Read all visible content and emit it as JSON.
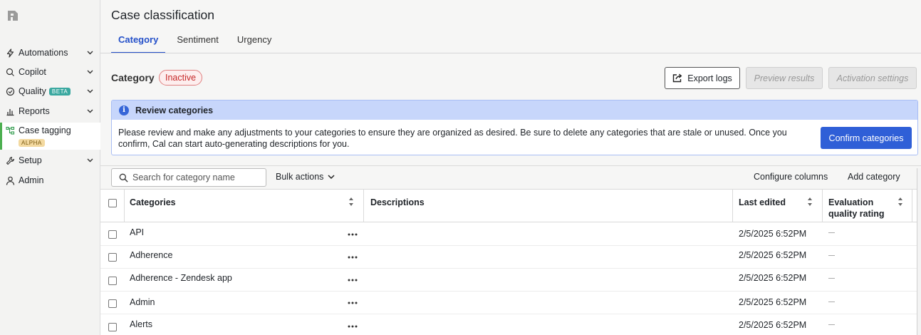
{
  "sidebar": {
    "items": [
      {
        "label": "Automations"
      },
      {
        "label": "Copilot"
      },
      {
        "label": "Quality",
        "badge": "BETA"
      },
      {
        "label": "Reports"
      },
      {
        "label": "Case tagging",
        "badge": "ALPHA"
      },
      {
        "label": "Setup"
      },
      {
        "label": "Admin"
      }
    ]
  },
  "header": {
    "title": "Case classification",
    "tabs": [
      {
        "label": "Category"
      },
      {
        "label": "Sentiment"
      },
      {
        "label": "Urgency"
      }
    ]
  },
  "section": {
    "title": "Category",
    "status": "Inactive",
    "buttons": {
      "export": "Export logs",
      "preview": "Preview results",
      "activation": "Activation settings"
    }
  },
  "banner": {
    "title": "Review categories",
    "body": "Please review and make any adjustments to your categories to ensure they are organized as desired. Be sure to delete any categories that are stale or unused. Once you confirm, Cal can start auto-generating descriptions for you.",
    "confirm": "Confirm categories"
  },
  "toolbar": {
    "search_placeholder": "Search for category name",
    "bulk_actions": "Bulk actions",
    "configure_columns": "Configure columns",
    "add_category": "Add category"
  },
  "table": {
    "columns": [
      "Categories",
      "Descriptions",
      "Last edited",
      "Evaluation quality rating"
    ],
    "rows": [
      {
        "name": "API",
        "last_edited": "2/5/2025 6:52PM",
        "rating": "—"
      },
      {
        "name": "Adherence",
        "last_edited": "2/5/2025 6:52PM",
        "rating": "—"
      },
      {
        "name": "Adherence - Zendesk app",
        "last_edited": "2/5/2025 6:52PM",
        "rating": "—"
      },
      {
        "name": "Admin",
        "last_edited": "2/5/2025 6:52PM",
        "rating": "—"
      },
      {
        "name": "Alerts",
        "last_edited": "2/5/2025 6:52PM",
        "rating": "—"
      }
    ]
  },
  "colors": {
    "accent": "#2450c9",
    "primary_button": "#2f5fd7",
    "inactive_badge": "#c62828",
    "banner_head": "#c7d6fb",
    "active_nav_bar": "#4caf50"
  },
  "icons": [
    "logo-icon",
    "bolt-icon",
    "copilot-icon",
    "quality-check-icon",
    "reports-bar-icon",
    "tag-tree-icon",
    "wrench-icon",
    "user-icon",
    "chevron-down-icon",
    "export-icon",
    "info-icon",
    "search-icon",
    "sort-icon",
    "more-dots-icon"
  ]
}
